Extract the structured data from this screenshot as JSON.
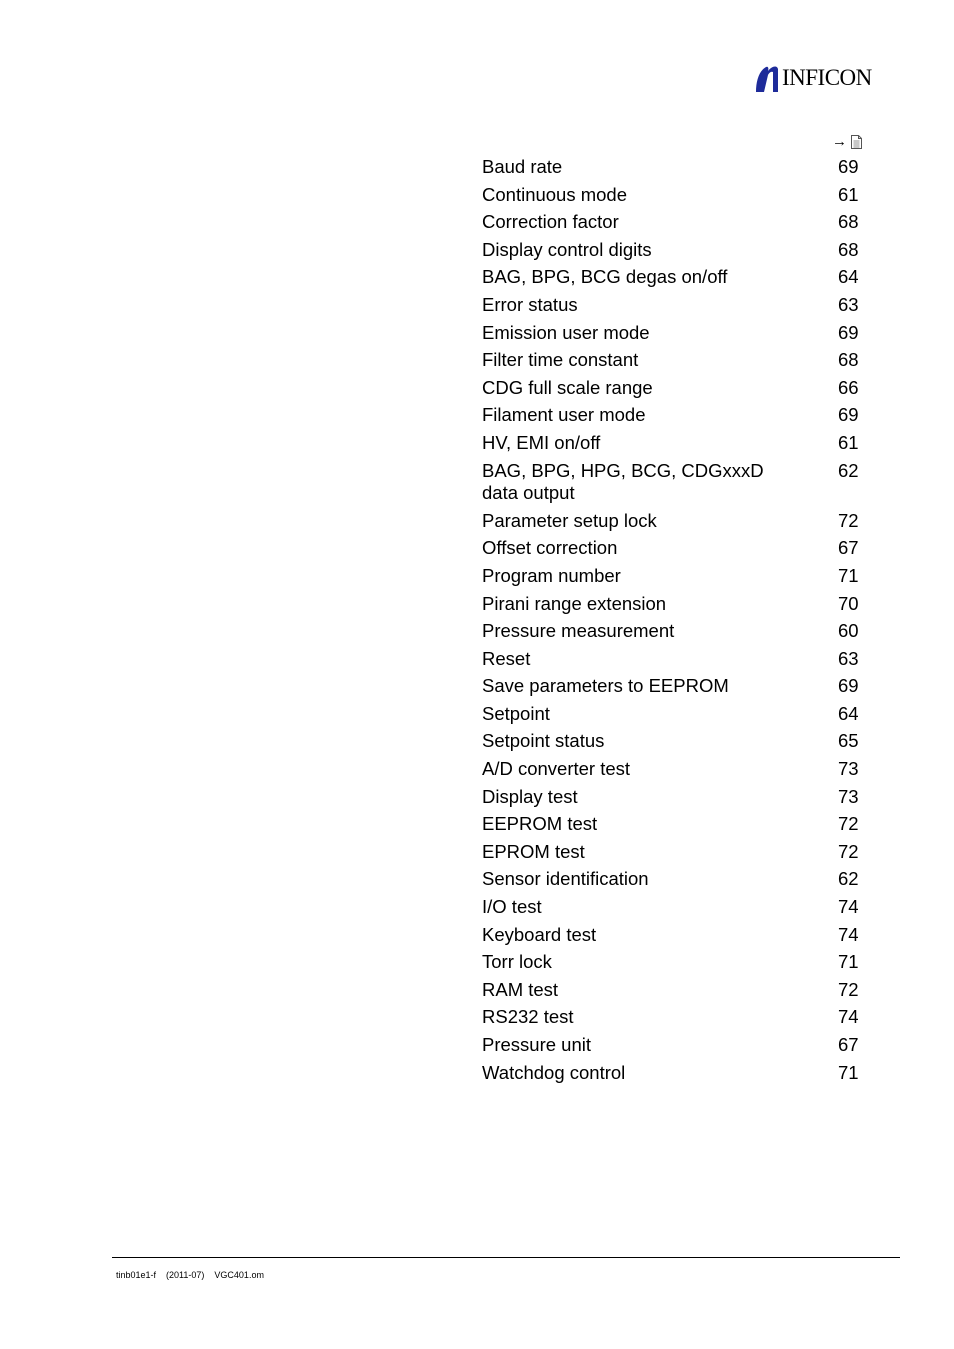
{
  "header": {
    "logo_text": "INFICON",
    "brand_color": "#1e2b9a"
  },
  "reference": {
    "arrow": "→",
    "icon": "document-icon"
  },
  "index_entries": [
    {
      "label": "Baud rate",
      "page": "69"
    },
    {
      "label": "Continuous mode",
      "page": "61"
    },
    {
      "label": "Correction factor",
      "page": "68"
    },
    {
      "label": "Display control digits",
      "page": "68"
    },
    {
      "label": "BAG, BPG, BCG degas on/off",
      "page": "64"
    },
    {
      "label": "Error status",
      "page": "63"
    },
    {
      "label": "Emission user mode",
      "page": "69"
    },
    {
      "label": "Filter time constant",
      "page": "68"
    },
    {
      "label": "CDG full scale range",
      "page": "66"
    },
    {
      "label": "Filament user mode",
      "page": "69"
    },
    {
      "label": "HV, EMI on/off",
      "page": "61"
    },
    {
      "label": "BAG, BPG, HPG, BCG, CDGxxxD data output",
      "page": "62"
    },
    {
      "label": "Parameter setup lock",
      "page": "72"
    },
    {
      "label": "Offset correction",
      "page": "67"
    },
    {
      "label": "Program number",
      "page": "71"
    },
    {
      "label": "Pirani range extension",
      "page": "70"
    },
    {
      "label": "Pressure measurement",
      "page": "60"
    },
    {
      "label": "Reset",
      "page": "63"
    },
    {
      "label": "Save parameters to EEPROM",
      "page": "69"
    },
    {
      "label": "Setpoint",
      "page": "64"
    },
    {
      "label": "Setpoint status",
      "page": "65"
    },
    {
      "label": "A/D converter test",
      "page": "73"
    },
    {
      "label": "Display test",
      "page": "73"
    },
    {
      "label": "EEPROM test",
      "page": "72"
    },
    {
      "label": "EPROM test",
      "page": "72"
    },
    {
      "label": "Sensor identification",
      "page": "62"
    },
    {
      "label": "I/O test",
      "page": "74"
    },
    {
      "label": "Keyboard test",
      "page": "74"
    },
    {
      "label": "Torr lock",
      "page": "71"
    },
    {
      "label": "RAM test",
      "page": "72"
    },
    {
      "label": "RS232 test",
      "page": "74"
    },
    {
      "label": "Pressure unit",
      "page": "67"
    },
    {
      "label": "Watchdog control",
      "page": "71"
    }
  ],
  "footer": {
    "doc_id": "tinb01e1-f",
    "date": "(2011-07)",
    "file": "VGC401.om"
  }
}
